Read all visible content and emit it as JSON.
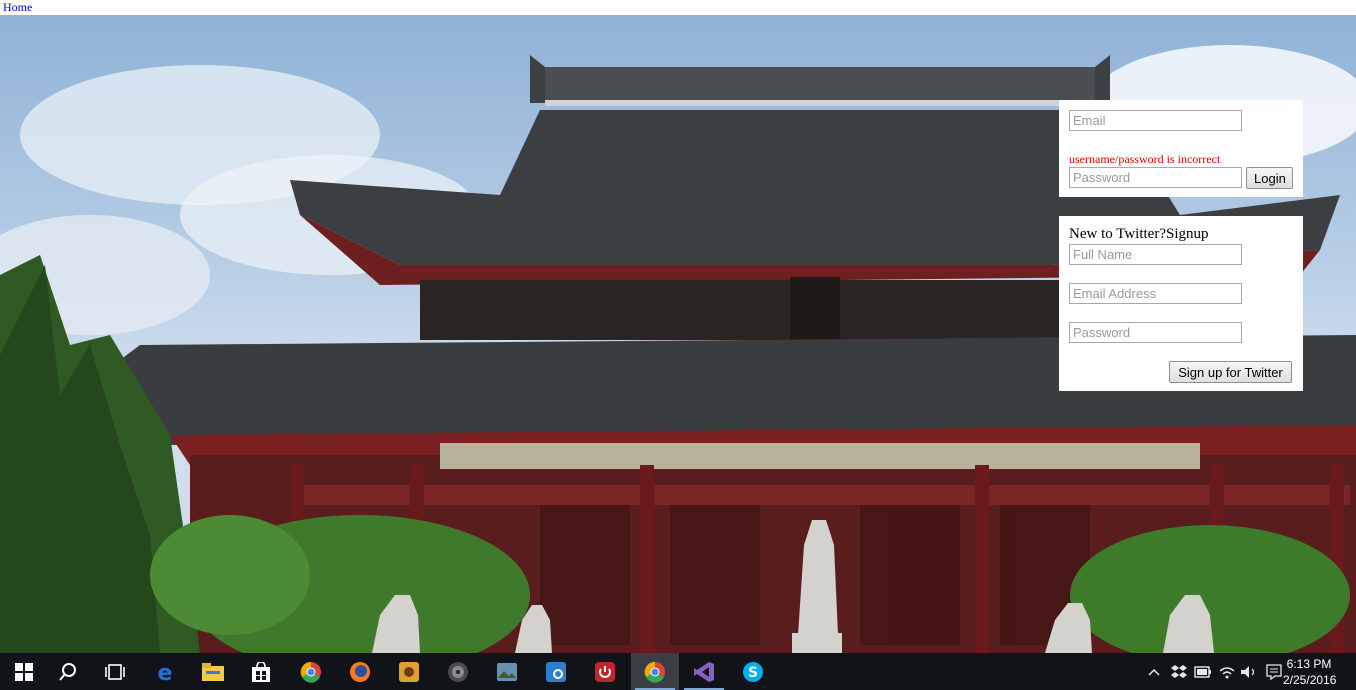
{
  "nav": {
    "home_label": "Home"
  },
  "login": {
    "email_placeholder": "Email",
    "password_placeholder": "Password",
    "error_message": "username/password is incorrect",
    "login_button": "Login"
  },
  "signup": {
    "heading": "New to Twitter?Signup",
    "fullname_placeholder": "Full Name",
    "email_placeholder": "Email Address",
    "password_placeholder": "Password",
    "submit_button": "Sign up for Twitter"
  },
  "taskbar": {
    "apps": [
      {
        "name": "windows-start-icon",
        "color": "#ffffff"
      },
      {
        "name": "search-icon",
        "color": "#ffffff"
      },
      {
        "name": "task-view-icon",
        "color": "#ffffff"
      },
      {
        "name": "edge-icon",
        "color": "#1e73d8"
      },
      {
        "name": "file-explorer-icon",
        "color": "#f2c94c"
      },
      {
        "name": "store-icon",
        "color": "#ffffff"
      },
      {
        "name": "chrome-icon",
        "color": "#34a853"
      },
      {
        "name": "firefox-icon",
        "color": "#ff7a1a"
      },
      {
        "name": "media-app-icon",
        "color": "#e0a030"
      },
      {
        "name": "speaker-app-icon",
        "color": "#8a8a8a"
      },
      {
        "name": "photos-app-icon",
        "color": "#6b8fb3"
      },
      {
        "name": "settings-app-icon",
        "color": "#2f7fd0"
      },
      {
        "name": "power-app-icon",
        "color": "#c0262d"
      },
      {
        "name": "chrome-icon",
        "color": "#34a853"
      },
      {
        "name": "visual-studio-icon",
        "color": "#8661c5"
      },
      {
        "name": "skype-icon",
        "color": "#00aff0"
      }
    ],
    "tray": {
      "chevron": "chevron-up-icon",
      "time": "6:13 PM",
      "date": "2/25/2016"
    }
  }
}
